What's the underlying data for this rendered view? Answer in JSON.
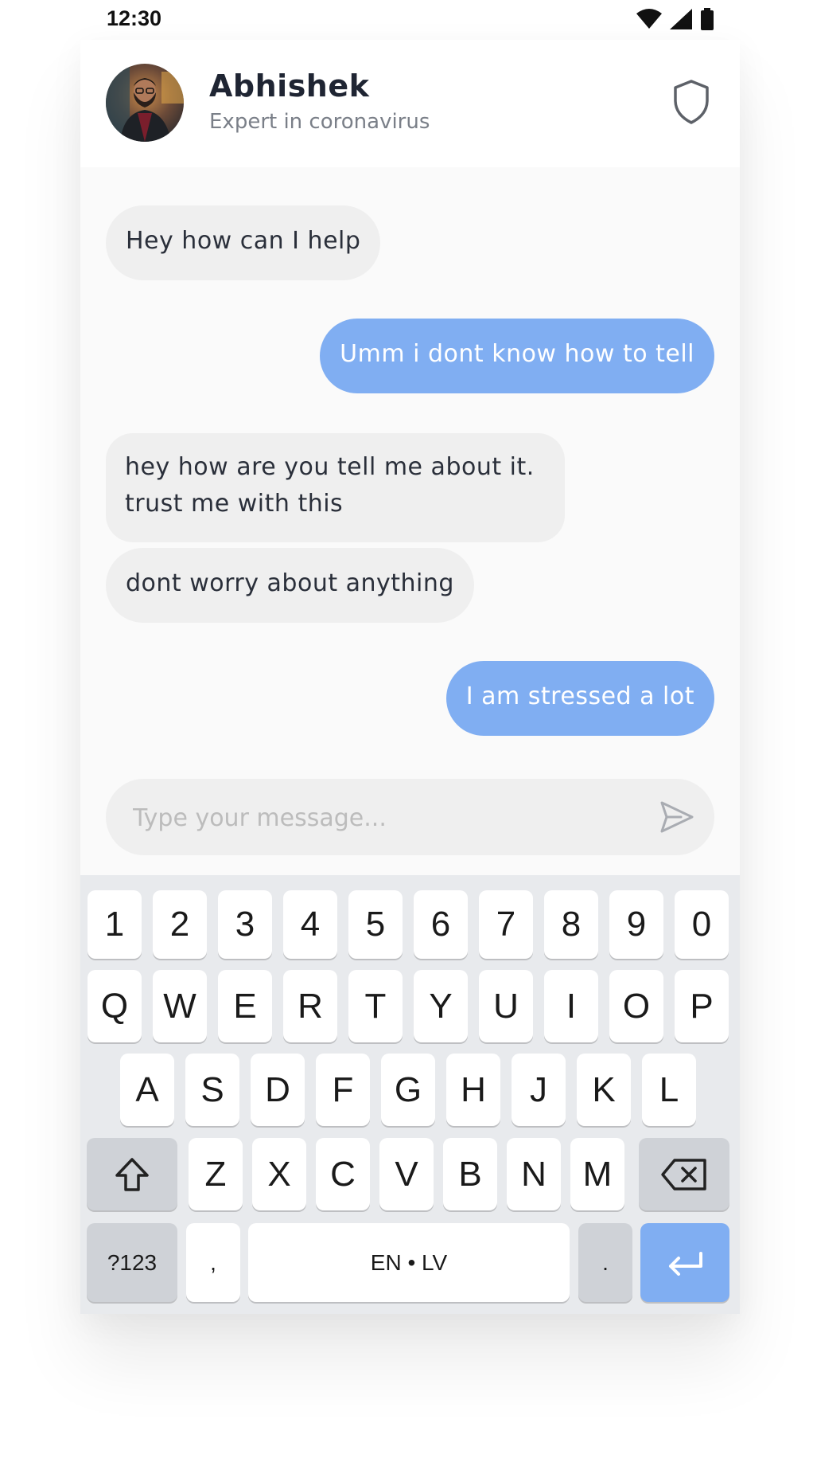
{
  "status_bar": {
    "time": "12:30",
    "icons": [
      "wifi-icon",
      "signal-icon",
      "battery-icon"
    ]
  },
  "header": {
    "name": "Abhishek",
    "subtitle": "Expert in coronavirus",
    "avatar": "avatar",
    "action_icon": "shield-icon"
  },
  "messages": [
    {
      "side": "in",
      "text": "Hey how can I help"
    },
    {
      "side": "out",
      "text": "Umm i dont know how to tell"
    },
    {
      "side": "in",
      "text": "hey how are you tell me about it.\ntrust me with this"
    },
    {
      "side": "in",
      "text": "dont worry about anything"
    },
    {
      "side": "out",
      "text": "I am stressed a lot"
    }
  ],
  "composer": {
    "placeholder": "Type your message...",
    "value": "",
    "send_icon": "send-icon"
  },
  "keyboard": {
    "row_numbers": [
      "1",
      "2",
      "3",
      "4",
      "5",
      "6",
      "7",
      "8",
      "9",
      "0"
    ],
    "row_top": [
      "Q",
      "W",
      "E",
      "R",
      "T",
      "Y",
      "U",
      "I",
      "O",
      "P"
    ],
    "row_middle": [
      "A",
      "S",
      "D",
      "F",
      "G",
      "H",
      "J",
      "K",
      "L"
    ],
    "row_bottom": [
      "Z",
      "X",
      "C",
      "V",
      "B",
      "N",
      "M"
    ],
    "shift_icon": "shift-icon",
    "backspace_icon": "backspace-icon",
    "symbols_label": "?123",
    "comma_label": ",",
    "space_label": "EN • LV",
    "period_label": ".",
    "enter_icon": "enter-icon"
  },
  "colors": {
    "accent": "#80aef2",
    "incoming_bubble": "#efefef",
    "chat_background": "#fafafa",
    "keyboard_background": "#e8eaed"
  }
}
